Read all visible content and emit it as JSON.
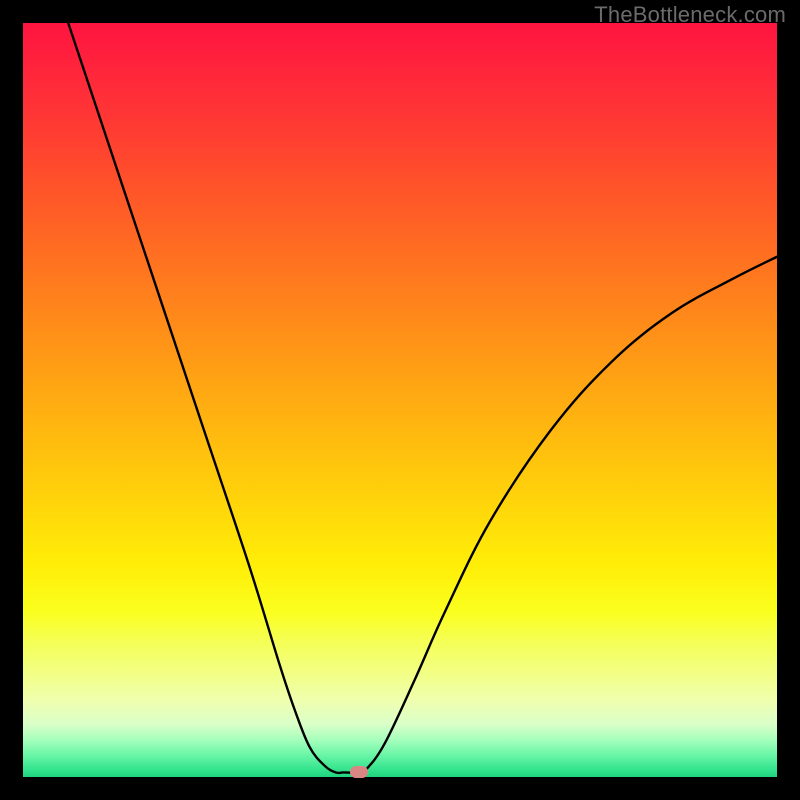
{
  "watermark": "TheBottleneck.com",
  "colors": {
    "frame": "#000000",
    "curve": "#000000",
    "marker": "#d98684"
  },
  "chart_data": {
    "type": "line",
    "title": "",
    "xlabel": "",
    "ylabel": "",
    "xlim": [
      0,
      100
    ],
    "ylim": [
      0,
      100
    ],
    "grid": false,
    "note": "Values are estimated from pixel positions; no axis tick labels are rendered in the image.",
    "series": [
      {
        "name": "bottleneck-curve",
        "x": [
          6,
          12,
          18,
          24,
          30,
          34,
          36,
          38,
          40,
          41.5,
          42.5,
          44.5,
          45.5,
          48,
          52,
          56,
          62,
          70,
          78,
          86,
          94,
          100
        ],
        "y": [
          100,
          82,
          64,
          46,
          28,
          15,
          9,
          4,
          1.5,
          0.6,
          0.6,
          0.6,
          1.0,
          4.5,
          13,
          22,
          34,
          46,
          55,
          61.5,
          66,
          69
        ]
      }
    ],
    "flat_min": {
      "x_start": 41.5,
      "x_end": 44.5,
      "y": 0.6
    },
    "marker": {
      "x": 44.5,
      "y": 0.6
    },
    "gradient_stops": [
      {
        "pos": 0,
        "color": "#ff1440"
      },
      {
        "pos": 50,
        "color": "#ffae10"
      },
      {
        "pos": 78,
        "color": "#fbff1e"
      },
      {
        "pos": 100,
        "color": "#1fd37e"
      }
    ]
  }
}
